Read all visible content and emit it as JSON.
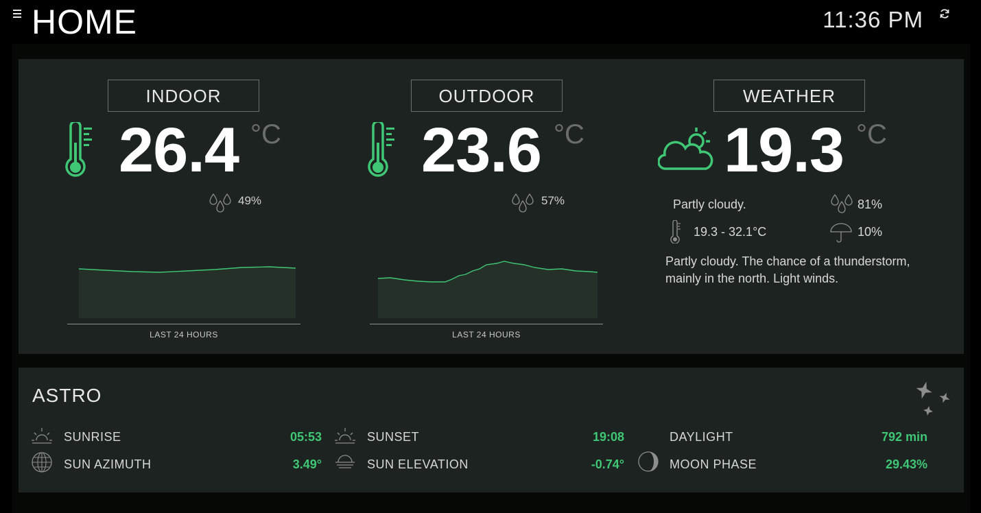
{
  "header": {
    "title": "HOME",
    "time": "11:36 PM"
  },
  "colors": {
    "accent": "#3fc775",
    "panel": "#1c2320",
    "background": "#000000"
  },
  "sensors": [
    {
      "label": "INDOOR",
      "value": "26.4",
      "unit": "°C",
      "humidity": "49%",
      "chart_caption": "LAST 24 HOURS"
    },
    {
      "label": "OUTDOOR",
      "value": "23.6",
      "unit": "°C",
      "humidity": "57%",
      "chart_caption": "LAST 24 HOURS"
    }
  ],
  "weather": {
    "label": "WEATHER",
    "value": "19.3",
    "unit": "°C",
    "condition": "Partly cloudy.",
    "humidity": "81%",
    "range": "19.3 - 32.1°C",
    "rain_chance": "10%",
    "description": "Partly cloudy. The chance of a thunderstorm, mainly in the north. Light winds."
  },
  "astro": {
    "title": "ASTRO",
    "items": [
      {
        "label": "SUNRISE",
        "value": "05:53",
        "icon": "sunrise-icon"
      },
      {
        "label": "SUNSET",
        "value": "19:08",
        "icon": "sunset-icon"
      },
      {
        "label": "DAYLIGHT",
        "value": "792 min",
        "icon": ""
      },
      {
        "label": "SUN AZIMUTH",
        "value": "3.49°",
        "icon": "globe-icon"
      },
      {
        "label": "SUN ELEVATION",
        "value": "-0.74°",
        "icon": "horizon-icon"
      },
      {
        "label": "MOON PHASE",
        "value": "29.43%",
        "icon": "moon-icon"
      }
    ]
  }
}
